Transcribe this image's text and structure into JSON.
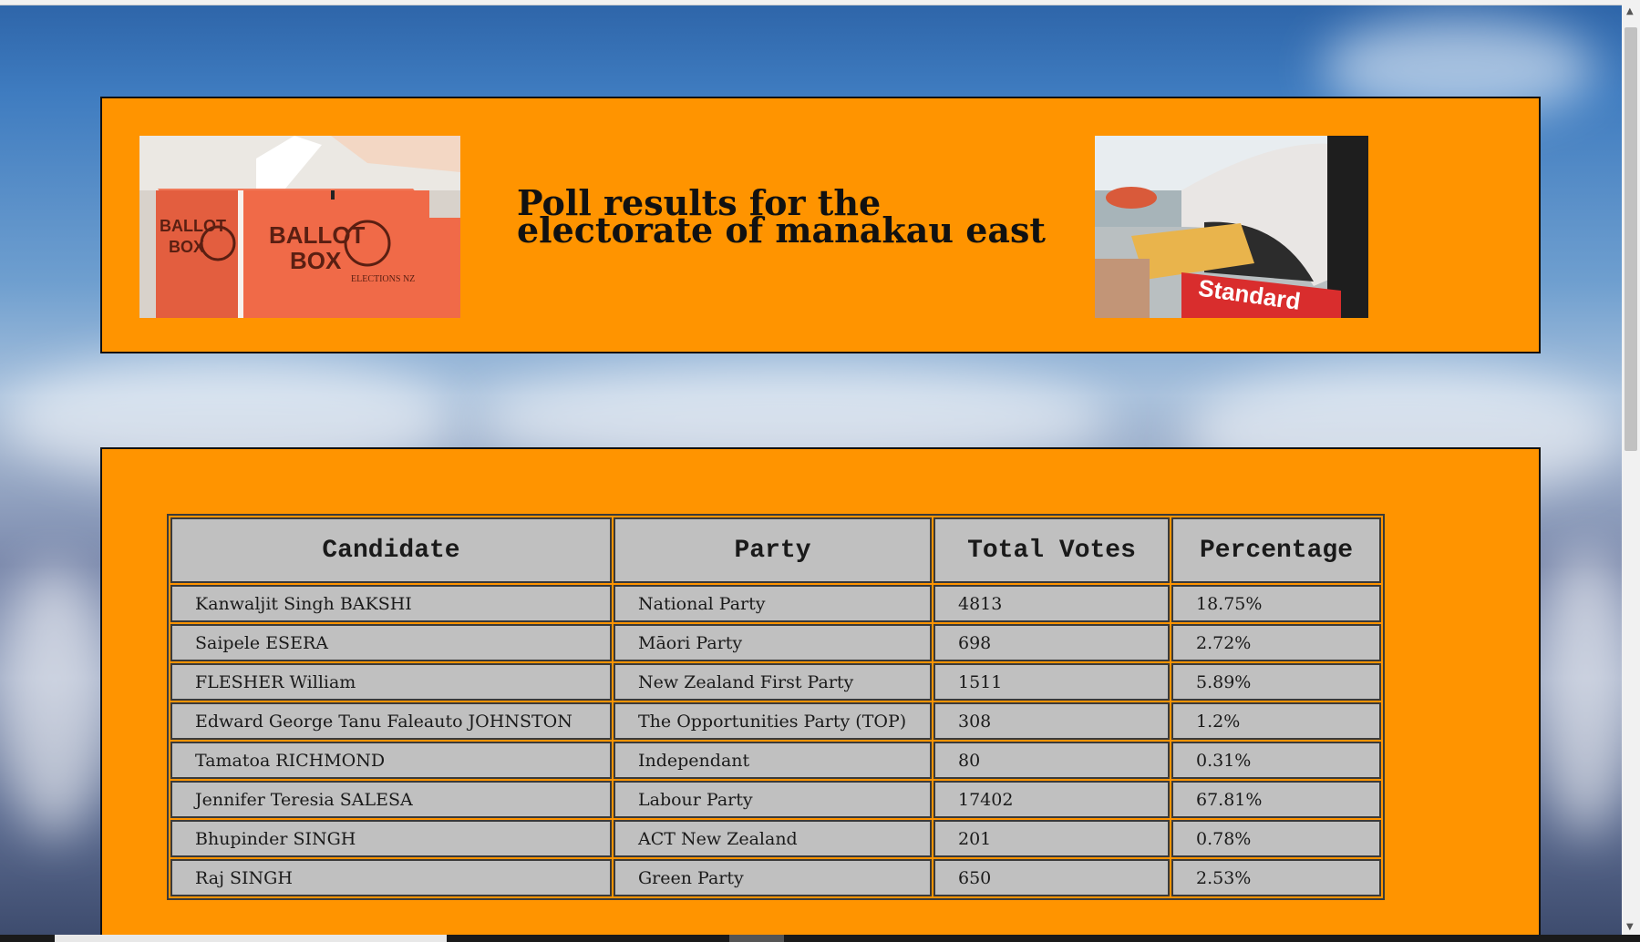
{
  "page": {
    "title_line1": "Poll results for the",
    "title_line2": "electorate of manakau east"
  },
  "images": {
    "ballot_box": {
      "text_1": "BALLOT",
      "text_2": "BOX",
      "text_3": "ELECTIONS NZ"
    },
    "mailbox": {
      "text": "Standard"
    }
  },
  "table": {
    "headers": [
      "Candidate",
      "Party",
      "Total Votes",
      "Percentage"
    ],
    "rows": [
      [
        "Kanwaljit Singh BAKSHI",
        "National Party",
        "4813",
        "18.75%"
      ],
      [
        "Saipele ESERA",
        "Māori Party",
        "698",
        "2.72%"
      ],
      [
        "FLESHER William",
        "New Zealand First Party",
        "1511",
        "5.89%"
      ],
      [
        "Edward George Tanu Faleauto JOHNSTON",
        "The Opportunities Party (TOP)",
        "308",
        "1.2%"
      ],
      [
        "Tamatoa RICHMOND",
        "Independant",
        "80",
        "0.31%"
      ],
      [
        "Jennifer Teresia SALESA",
        "Labour Party",
        "17402",
        "67.81%"
      ],
      [
        "Bhupinder SINGH",
        "ACT New Zealand",
        "201",
        "0.78%"
      ],
      [
        "Raj SINGH",
        "Green Party",
        "650",
        "2.53%"
      ]
    ]
  },
  "colors": {
    "panel": "#ff9400",
    "cell": "#c0c0c0",
    "border": "#3a3a3a"
  }
}
